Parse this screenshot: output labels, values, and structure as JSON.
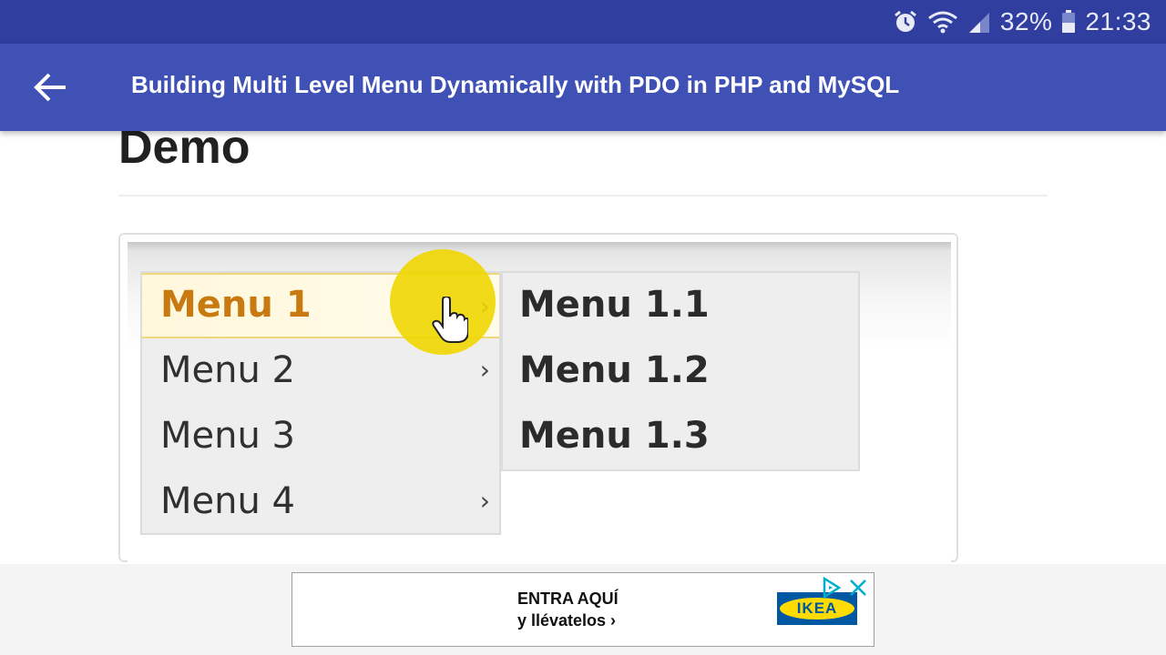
{
  "status_bar": {
    "battery": "32%",
    "time": "21:33",
    "icons": [
      "alarm-icon",
      "wifi-icon",
      "signal-icon",
      "battery-icon"
    ]
  },
  "app_bar": {
    "back_icon": "arrow-left-icon",
    "title": "Building Multi Level Menu Dynamically with PDO in PHP and MySQL"
  },
  "content": {
    "heading": "Demo",
    "demo": {
      "menu_items": [
        {
          "label": "Menu 1",
          "has_submenu": true,
          "active": true
        },
        {
          "label": "Menu 2",
          "has_submenu": true
        },
        {
          "label": "Menu 3",
          "has_submenu": false
        },
        {
          "label": "Menu 4",
          "has_submenu": true
        }
      ],
      "arrow": "›",
      "submenu_items": [
        {
          "label": "Menu 1.1"
        },
        {
          "label": "Menu 1.2"
        },
        {
          "label": "Menu 1.3"
        }
      ]
    }
  },
  "ad": {
    "line1": "ENTRA AQUÍ",
    "line2": "y llévatelos ›",
    "logo": "IKEA",
    "icons": [
      "adchoices-icon",
      "close-icon"
    ]
  },
  "colors": {
    "status_bar": "#303f9f",
    "app_bar": "#3f51b5",
    "highlight": "#f0d600",
    "ikea_blue": "#0058a3",
    "ikea_yellow": "#ffdb00"
  }
}
